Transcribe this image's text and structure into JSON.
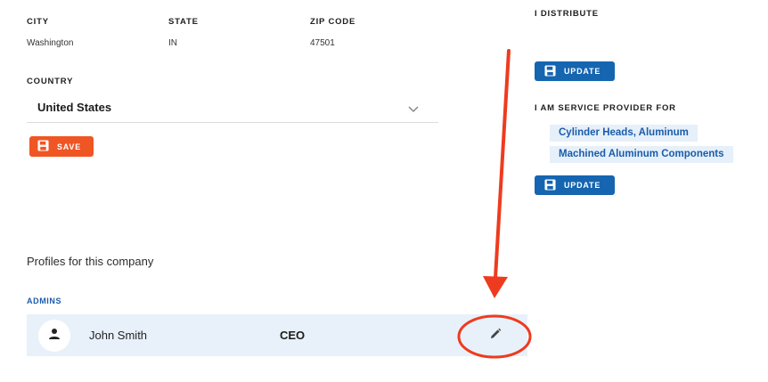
{
  "address": {
    "city_label": "CITY",
    "city_value": "Washington",
    "state_label": "STATE",
    "state_value": "IN",
    "zip_label": "ZIP CODE",
    "zip_value": "47501",
    "country_label": "COUNTRY",
    "country_value": "United States",
    "save_label": "SAVE"
  },
  "right_panel": {
    "distribute_label": "I DISTRIBUTE",
    "update_label": "UPDATE",
    "service_provider_label": "I AM SERVICE PROVIDER FOR",
    "service_tags": [
      "Cylinder Heads, Aluminum",
      "Machined Aluminum Components"
    ],
    "update_label_2": "UPDATE"
  },
  "profiles": {
    "title": "Profiles for this company",
    "admins_label": "ADMINS",
    "rows": [
      {
        "name": "John Smith",
        "role": "CEO"
      }
    ]
  },
  "icons": {
    "save": "floppy-disk-icon",
    "chevron": "chevron-down-icon",
    "person": "person-icon",
    "edit": "pencil-icon"
  },
  "colors": {
    "save_button": "#f05524",
    "update_button": "#1565b0",
    "tag_bg": "#e6f0fa",
    "tag_text": "#1b5caa",
    "row_bg": "#e8f1fa",
    "annotation": "#ee3b1f"
  }
}
